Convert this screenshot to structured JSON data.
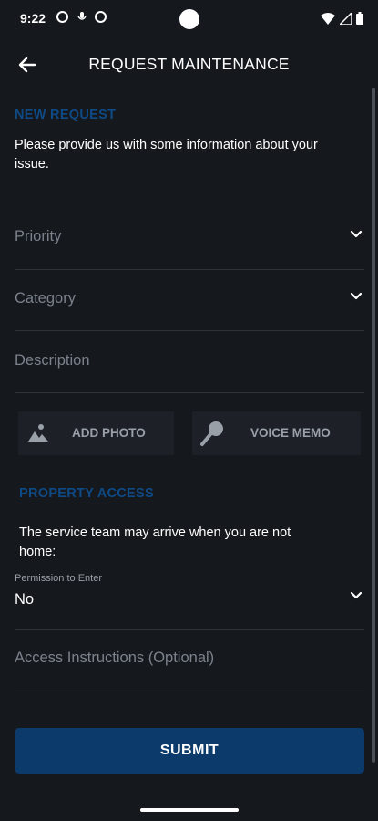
{
  "status_bar": {
    "time": "9:22"
  },
  "app_bar": {
    "title": "REQUEST MAINTENANCE"
  },
  "new_request": {
    "section_title": "NEW REQUEST",
    "info_line1": "Please provide us with some information about your",
    "info_line2": "issue."
  },
  "fields": {
    "priority": "Priority",
    "category": "Category",
    "description": "Description"
  },
  "media": {
    "add_photo": "ADD PHOTO",
    "voice_memo": "VOICE MEMO"
  },
  "property_access": {
    "section_title": "PROPERTY ACCESS",
    "info_line1": "The service team may arrive when you are not",
    "info_line2": "home:",
    "permission_label": "Permission to Enter",
    "permission_value": "No",
    "instructions_placeholder": "Access Instructions (Optional)"
  },
  "submit_label": "SUBMIT",
  "colors": {
    "background": "#15181d",
    "accent": "#0e4a86",
    "button": "#0c3a6b"
  }
}
